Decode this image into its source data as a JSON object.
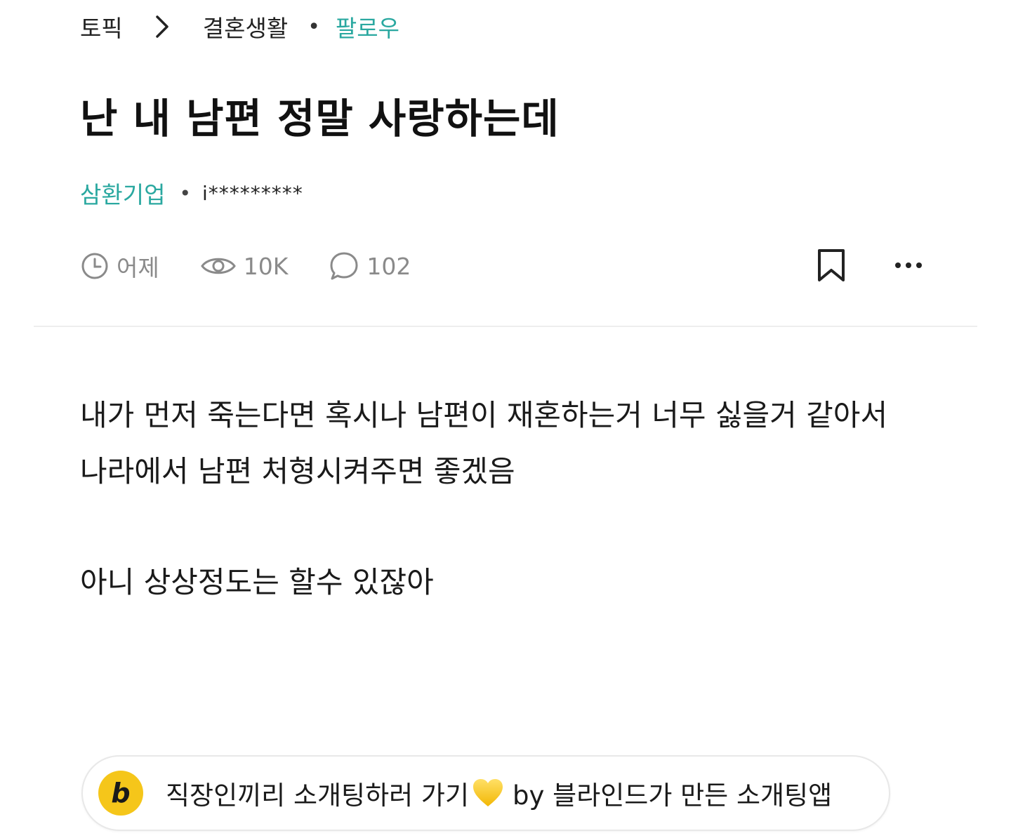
{
  "breadcrumb": {
    "root": "토픽",
    "category": "결혼생활",
    "follow": "팔로우"
  },
  "post": {
    "title": "난 내 남편 정말 사랑하는데",
    "company": "삼환기업",
    "author": "i*********",
    "time": "어제",
    "views": "10K",
    "comments": "102",
    "body_line1": "내가 먼저 죽는다면 혹시나 남편이 재혼하는거 너무 싫을거 같아서",
    "body_line2": "나라에서 남편 처형시켜주면 좋겠음",
    "body_line3": "아니 상상정도는 할수 있잖아"
  },
  "promo": {
    "logo_letter": "b",
    "text_before": "직장인끼리 소개팅하러 가기",
    "text_after": "by 블라인드가 만든 소개팅앱"
  },
  "colors": {
    "accent": "#2aa8a0",
    "logo": "#f5c61a",
    "muted": "#8a8a8a"
  }
}
